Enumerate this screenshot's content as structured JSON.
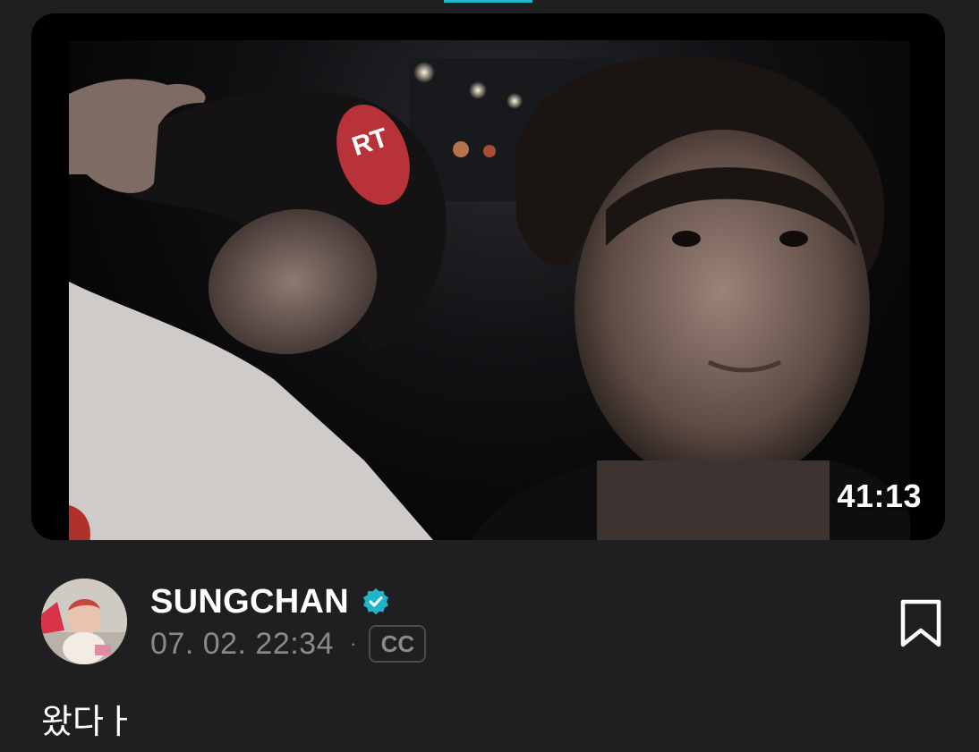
{
  "video": {
    "duration": "41:13"
  },
  "author": {
    "name": "SUNGCHAN",
    "verified": true,
    "date": "07. 02. 22:34",
    "separator": "·",
    "cc_label": "CC"
  },
  "post": {
    "caption": "왔다ㅏ"
  },
  "colors": {
    "background": "#1f1f21",
    "accent": "#1fb5c8",
    "muted_text": "#8a8a8d"
  },
  "icons": {
    "verified": "verified-badge-icon",
    "bookmark": "bookmark-outline-icon"
  }
}
